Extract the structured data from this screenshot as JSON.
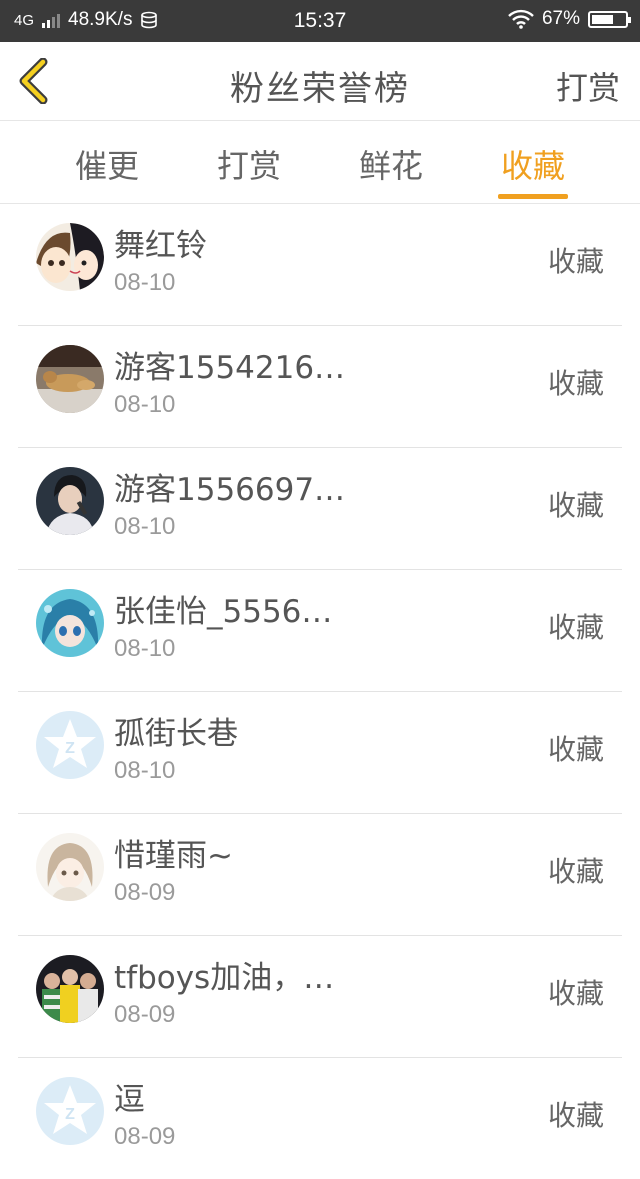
{
  "status_bar": {
    "network": "4G",
    "speed": "48.9K/s",
    "time": "15:37",
    "battery": "67%",
    "battery_level": 0.67,
    "icons": [
      "signal-icon",
      "storage-icon",
      "wifi-icon",
      "battery-icon"
    ]
  },
  "header": {
    "title": "粉丝荣誉榜",
    "action": "打赏",
    "back_icon": "chevron-left-icon"
  },
  "tabs": [
    {
      "label": "催更",
      "active": false
    },
    {
      "label": "打赏",
      "active": false
    },
    {
      "label": "鲜花",
      "active": false
    },
    {
      "label": "收藏",
      "active": true
    }
  ],
  "colors": {
    "accent": "#f0a020",
    "status_bar_bg": "#3a3a3a"
  },
  "rows": [
    {
      "name": "舞红铃",
      "date": "08-10",
      "action": "收藏",
      "avatar": "anime-couple-avatar"
    },
    {
      "name": "游客1554216…",
      "date": "08-10",
      "action": "收藏",
      "avatar": "dog-photo-avatar"
    },
    {
      "name": "游客1556697…",
      "date": "08-10",
      "action": "收藏",
      "avatar": "singer-photo-avatar"
    },
    {
      "name": "张佳怡_5556…",
      "date": "08-10",
      "action": "收藏",
      "avatar": "anime-girl-blue-avatar"
    },
    {
      "name": "孤街长巷",
      "date": "08-10",
      "action": "收藏",
      "avatar": "default-star-avatar"
    },
    {
      "name": "惜瑾雨~",
      "date": "08-09",
      "action": "收藏",
      "avatar": "anime-girl-sketch-avatar"
    },
    {
      "name": "tfboys加油，…",
      "date": "08-09",
      "action": "收藏",
      "avatar": "group-photo-avatar"
    },
    {
      "name": "逗",
      "date": "08-09",
      "action": "收藏",
      "avatar": "default-star-avatar"
    }
  ]
}
